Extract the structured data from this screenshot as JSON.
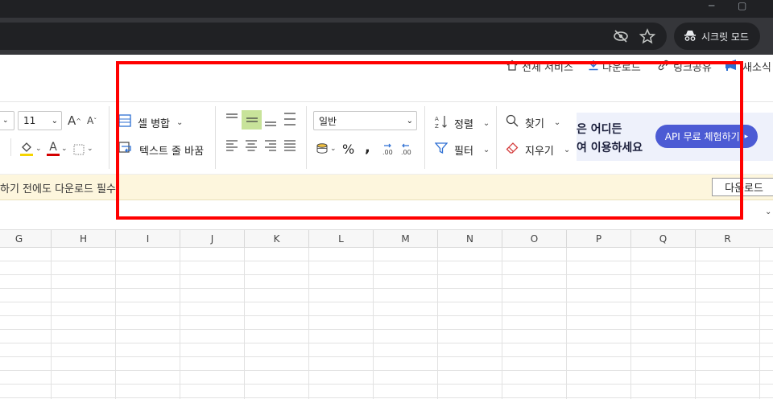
{
  "browser": {
    "incognito_label": "시크릿 모드"
  },
  "header_links": {
    "all_services": "전체 서비스",
    "download": "다운로드",
    "link_share": "링크공유",
    "new_file": "새소식"
  },
  "ribbon": {
    "font_size": "11",
    "merge_cells": "셀 병합",
    "wrap_text": "텍스트 줄 바꿈",
    "number_format": "일반",
    "sort": "정렬",
    "filter": "필터",
    "find": "찾기",
    "clear": "지우기",
    "percent": "%",
    "comma": ","
  },
  "banner": {
    "line1": "은 어디든",
    "line2": "여 이용하세요",
    "button": "API 무료 체험하기"
  },
  "notice": {
    "text": "하기 전에도 다운로드 필수!",
    "download_button": "다운로드"
  },
  "columns": [
    "G",
    "H",
    "I",
    "J",
    "K",
    "L",
    "M",
    "N",
    "O",
    "P",
    "Q",
    "R"
  ],
  "colors": {
    "highlight": "#ff0000",
    "banner_button": "#4c5bd4",
    "active_align": "#c8e39a",
    "fill_underline": "#f5d400",
    "font_underline": "#d40000"
  }
}
